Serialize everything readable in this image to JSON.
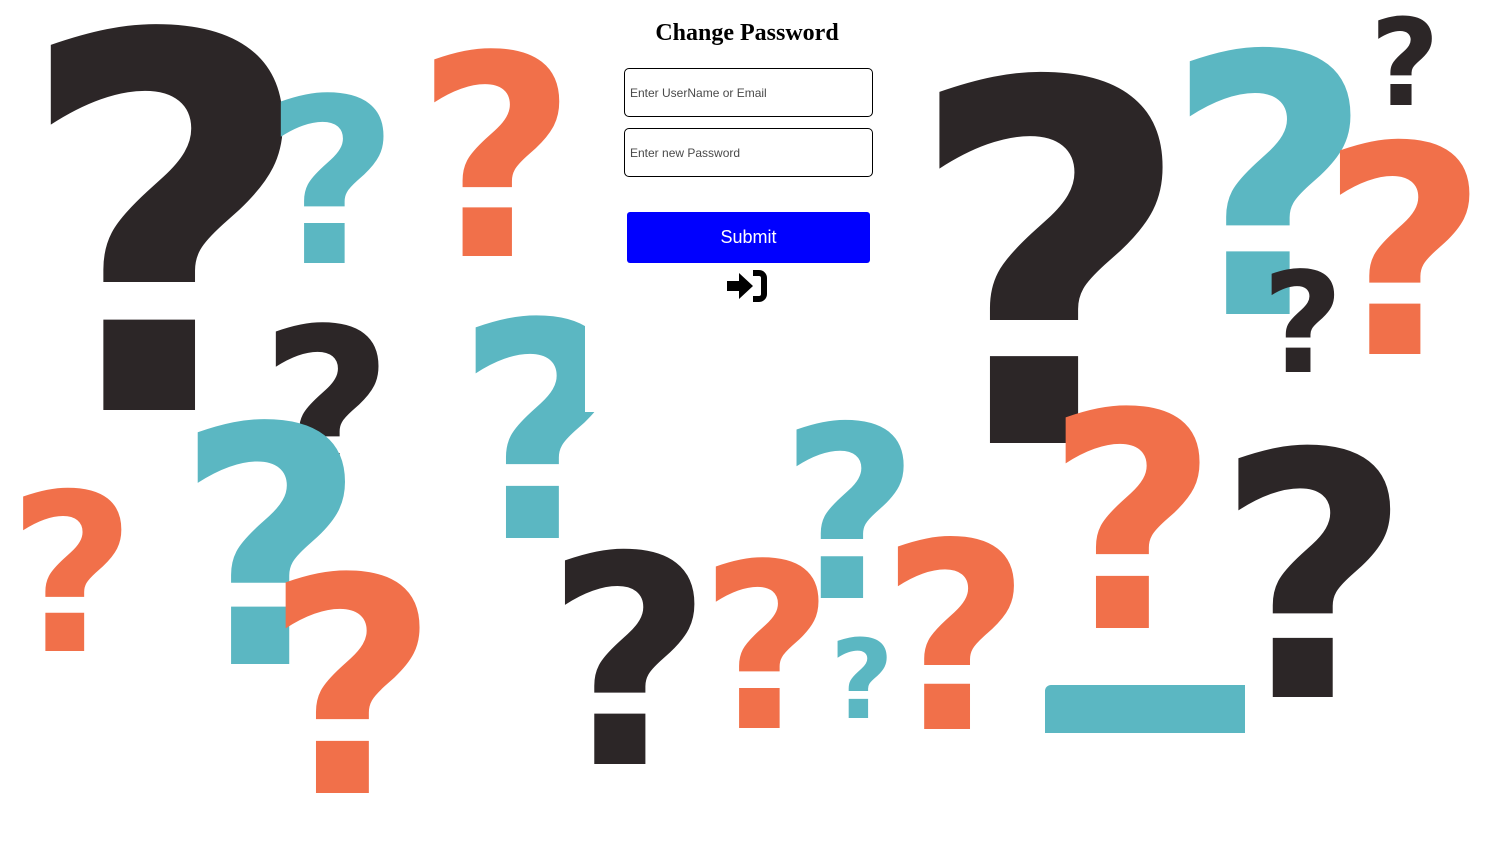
{
  "form": {
    "title": "Change Password",
    "username_placeholder": "Enter UserName or Email",
    "password_placeholder": "Enter new Password",
    "submit_label": "Submit",
    "login_icon": "sign-in-icon"
  },
  "background": {
    "glyph": "?",
    "colors": {
      "dark": "#2c2627",
      "teal": "#5bb7c2",
      "orange": "#f1704a"
    }
  }
}
